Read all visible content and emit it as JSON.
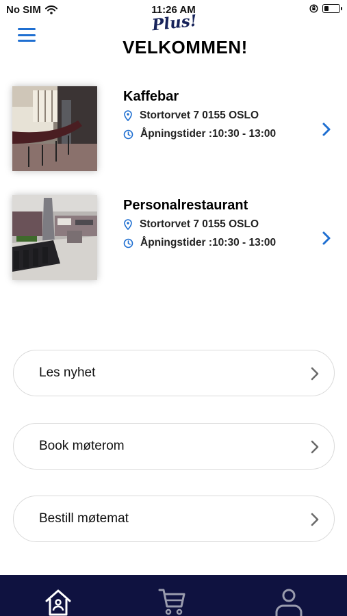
{
  "status_bar": {
    "carrier": "No SIM",
    "time": "11:26 AM",
    "battery_level": 0.3
  },
  "header": {
    "logo": "Plus!",
    "title": "VELKOMMEN!",
    "menu_icon": "hamburger-menu-icon",
    "accent_color": "#1f6fd1"
  },
  "venues": [
    {
      "name": "Kaffebar",
      "address": "Stortorvet 7 0155 OSLO",
      "hours": "Åpningstider :10:30 - 13:00"
    },
    {
      "name": "Personalrestaurant",
      "address": "Stortorvet 7 0155 OSLO",
      "hours": "Åpningstider :10:30 - 13:00"
    }
  ],
  "actions": [
    {
      "label": "Les nyhet"
    },
    {
      "label": "Book møterom"
    },
    {
      "label": "Bestill møtemat"
    }
  ],
  "bottom_nav": {
    "background": "#0f1240",
    "items": [
      "home-icon",
      "cart-icon",
      "user-icon"
    ]
  }
}
